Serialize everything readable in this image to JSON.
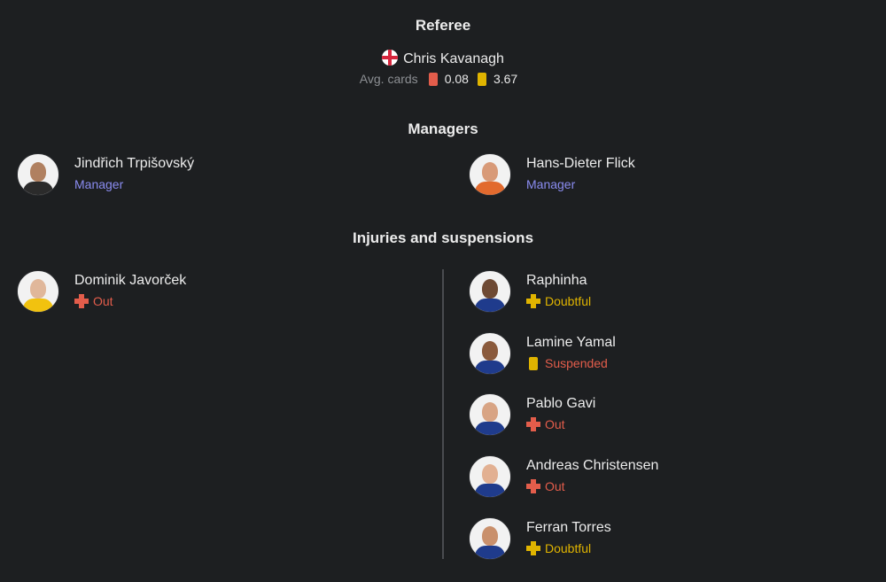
{
  "referee": {
    "title": "Referee",
    "name": "Chris Kavanagh",
    "avg_cards_label": "Avg. cards",
    "red_avg": "0.08",
    "yellow_avg": "3.67"
  },
  "managers": {
    "title": "Managers",
    "items": [
      {
        "name": "Jindřich Trpišovský",
        "role": "Manager"
      },
      {
        "name": "Hans-Dieter Flick",
        "role": "Manager"
      }
    ]
  },
  "injuries": {
    "title": "Injuries and suspensions",
    "home": [
      {
        "name": "Dominik Javorček",
        "status": "Out"
      }
    ],
    "away": [
      {
        "name": "Raphinha",
        "status": "Doubtful"
      },
      {
        "name": "Lamine Yamal",
        "status": "Suspended"
      },
      {
        "name": "Pablo Gavi",
        "status": "Out"
      },
      {
        "name": "Andreas Christensen",
        "status": "Out"
      },
      {
        "name": "Ferran Torres",
        "status": "Doubtful"
      }
    ]
  },
  "colors": {
    "background": "#1d1f21",
    "manager_role": "#8a8cf0",
    "out": "#e35d4b",
    "doubtful": "#e0b400",
    "suspended_text": "#e35d4b",
    "red_card": "#e35d4b",
    "yellow_card": "#e0b400"
  },
  "icons": {
    "flag": "england-flag-icon",
    "injury": "cross-icon",
    "suspension": "yellow-card-icon"
  }
}
